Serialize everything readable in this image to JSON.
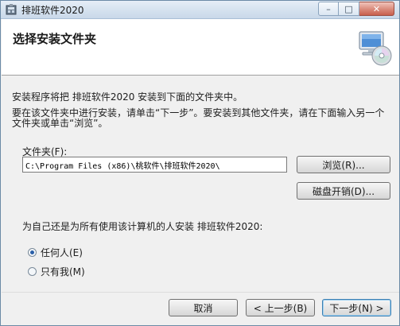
{
  "window": {
    "title": "排班软件2020",
    "minimize_glyph": "–",
    "restore_glyph": "□",
    "close_glyph": "✕"
  },
  "header": {
    "title": "选择安装文件夹"
  },
  "body": {
    "description_line1": "安装程序将把 排班软件2020 安装到下面的文件夹中。",
    "description_line2": "要在该文件夹中进行安装，请单击“下一步”。要安装到其他文件夹，请在下面输入另一个文件夹或单击“浏览”。",
    "folder_label": "文件夹(F):",
    "folder_path": "C:\\Program Files (x86)\\桃软件\\排班软件2020\\",
    "browse_label": "浏览(R)...",
    "disk_cost_label": "磁盘开销(D)...",
    "install_for_question": "为自己还是为所有使用该计算机的人安装 排班软件2020:",
    "options": [
      {
        "label": "任何人(E)",
        "selected": true
      },
      {
        "label": "只有我(M)",
        "selected": false
      }
    ]
  },
  "footer": {
    "cancel_label": "取消",
    "back_label": "< 上一步(B)",
    "next_label": "下一步(N) >"
  },
  "colors": {
    "accent": "#2a5fa8",
    "default_button_border": "#3c7fb1"
  },
  "icons": {
    "app": "app-icon",
    "header": "computer-cd-icon"
  }
}
